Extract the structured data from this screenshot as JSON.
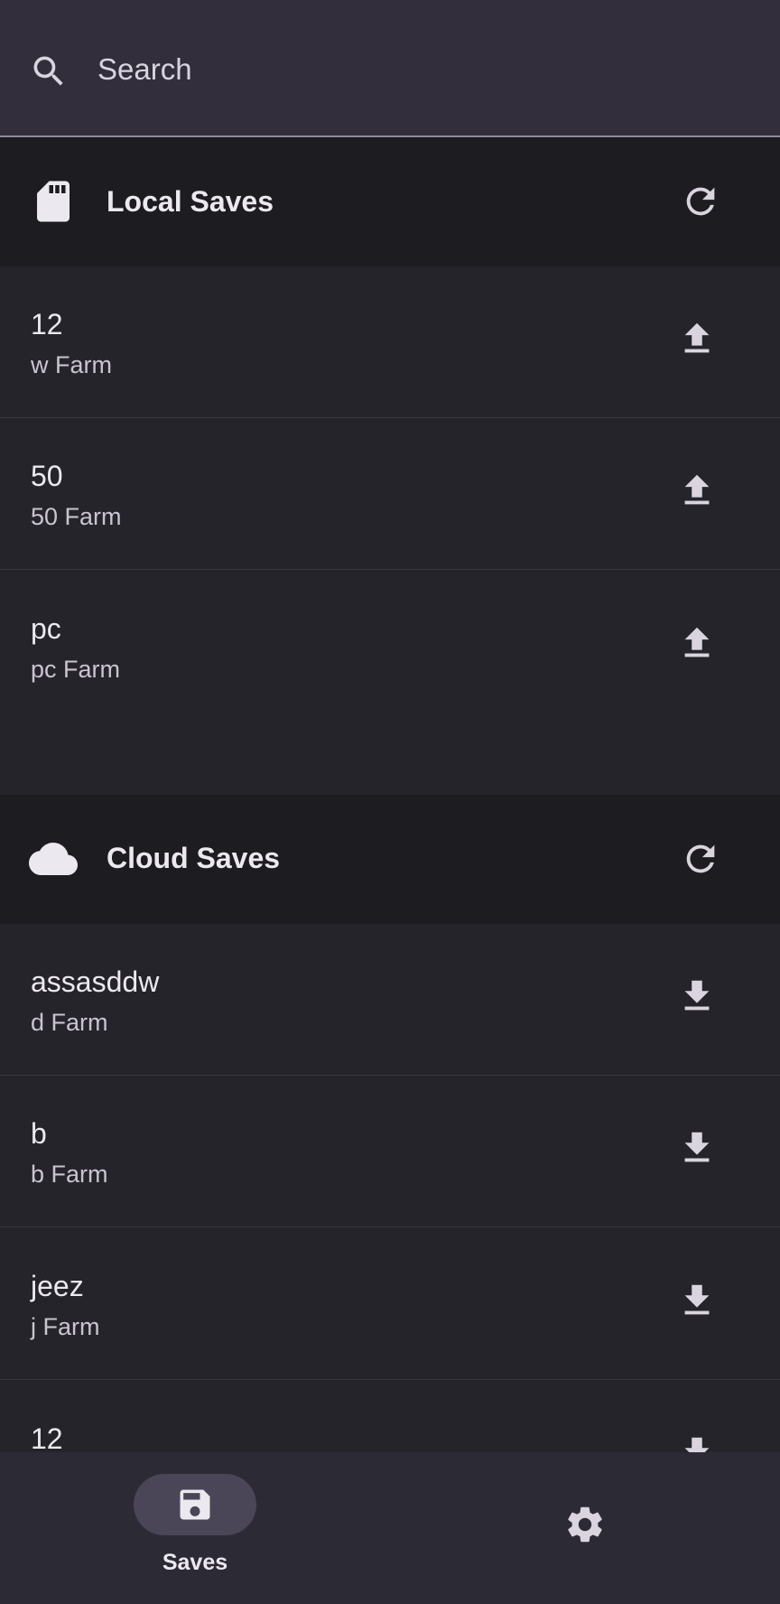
{
  "search": {
    "placeholder": "Search",
    "value": ""
  },
  "local": {
    "title": "Local Saves",
    "icon": "sd-card-icon",
    "action_icon": "upload-icon",
    "items": [
      {
        "title": "12",
        "subtitle": "w Farm"
      },
      {
        "title": "50",
        "subtitle": "50 Farm"
      },
      {
        "title": "pc",
        "subtitle": "pc Farm"
      }
    ]
  },
  "cloud": {
    "title": "Cloud Saves",
    "icon": "cloud-icon",
    "action_icon": "download-icon",
    "items": [
      {
        "title": "assasddw",
        "subtitle": "d Farm"
      },
      {
        "title": "b",
        "subtitle": "b Farm"
      },
      {
        "title": "jeez",
        "subtitle": "j Farm"
      },
      {
        "title": "12",
        "subtitle": ""
      }
    ]
  },
  "nav": {
    "saves_label": "Saves",
    "saves_icon": "floppy-disk-icon",
    "settings_icon": "gear-icon"
  },
  "colors": {
    "background": "#24232a",
    "search_bg": "#322e3b",
    "section_header_bg": "#1d1c21",
    "nav_bg": "#2c2a35",
    "active_pill": "#4a4658",
    "icon": "#d9d4de"
  }
}
